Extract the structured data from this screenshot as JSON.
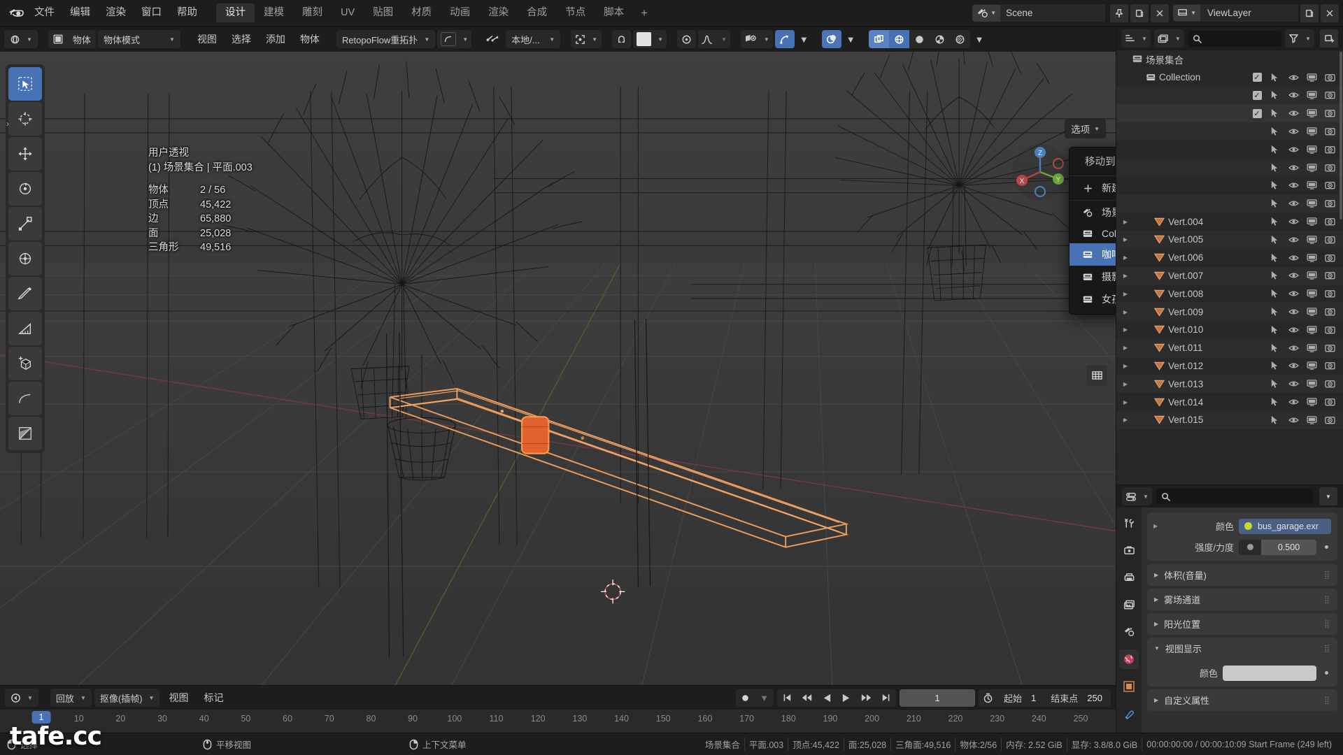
{
  "app": {
    "logo_icon": "blender-logo-icon"
  },
  "topbar": {
    "menus": [
      "文件",
      "编辑",
      "渲染",
      "窗口",
      "帮助"
    ],
    "workspaces": [
      "设计",
      "建模",
      "雕刻",
      "UV",
      "贴图",
      "材质",
      "动画",
      "渲染",
      "合成",
      "节点",
      "脚本"
    ],
    "active_workspace": "设计",
    "add_workspace_label": "+",
    "scene_name": "Scene",
    "viewlayer_name": "ViewLayer",
    "scene_icon": "scene-icon",
    "pin_icon": "pin-icon",
    "new_scene_icon": "new-scene-icon",
    "delete_scene_icon": "delete-scene-icon",
    "viewlayer_icon": "viewlayer-icon",
    "new_viewlayer_icon": "new-viewlayer-icon",
    "delete_viewlayer_icon": "delete-viewlayer-icon"
  },
  "viewport_header": {
    "editor_type_icon": "editor-type-3dview-icon",
    "mode_icon": "object-mode-icon",
    "mode_short_label": "物体",
    "mode_label": "物体模式",
    "menus": [
      "视图",
      "选择",
      "添加",
      "物体"
    ],
    "retopoflow_label": "RetopoFlow重拓扑",
    "retopoflow_tool_icon": "retopo-tool-icon",
    "transform_pivot_icon": "transform-pivot-icon",
    "orientation_label": "本地/...",
    "snap_icon": "snap-magnet-icon",
    "proportional_icon": "proportional-edit-icon",
    "visibility_icon": "object-visibility-icon",
    "gizmo_icon": "gizmo-icon",
    "overlays_icon": "overlays-icon",
    "xray_icon": "xray-icon",
    "shading_wireframe_icon": "shading-wireframe-icon",
    "shading_solid_icon": "shading-solid-icon",
    "shading_material_icon": "shading-material-icon",
    "shading_rendered_icon": "shading-rendered-icon",
    "options_label": "选项"
  },
  "viewport": {
    "view_name": "用户透视",
    "scene_path": "(1) 场景集合 | 平面.003",
    "stats": [
      {
        "label": "物体",
        "value": "2 / 56"
      },
      {
        "label": "顶点",
        "value": "45,422"
      },
      {
        "label": "边",
        "value": "65,880"
      },
      {
        "label": "面",
        "value": "25,028"
      },
      {
        "label": "三角形",
        "value": "49,516"
      }
    ],
    "tools": [
      "select-box-tool",
      "cursor-tool",
      "move-tool",
      "rotate-tool",
      "scale-tool",
      "transform-tool",
      "annotate-tool",
      "measure-tool",
      "add-cube-tool",
      "shear-tool",
      "to-sphere-tool"
    ],
    "gizmo_axes": [
      "X",
      "Y",
      "Z"
    ]
  },
  "context_menu": {
    "title": "移动到集合",
    "new_collection_label": "新建集合",
    "new_collection_icon": "plus-icon",
    "items": [
      {
        "label": "场景集合",
        "icon": "scene-collection-icon",
        "selected": false,
        "has_sub": false
      },
      {
        "label": "Collection",
        "icon": "collection-icon",
        "selected": false,
        "has_sub": false
      },
      {
        "label": "咖啡屋前景",
        "icon": "collection-icon",
        "selected": true,
        "has_sub": true
      },
      {
        "label": "摄影机与灯光",
        "icon": "collection-icon",
        "selected": false,
        "has_sub": false
      },
      {
        "label": "女孩",
        "icon": "collection-icon",
        "selected": false,
        "has_sub": true
      }
    ]
  },
  "outliner": {
    "editor_icon": "outliner-icon",
    "display_mode_icon": "view-layer-display-icon",
    "search_placeholder": "",
    "filter_icon": "filter-icon",
    "new_collection_icon": "new-collection-icon",
    "root": {
      "label": "场景集合",
      "icon": "scene-collection-icon"
    },
    "rows": [
      {
        "label": "Collection",
        "indent": 2,
        "icon": "collection-icon",
        "checkbox": true,
        "tri": false,
        "type": "collection"
      },
      {
        "label": "",
        "indent": 3,
        "icon": "",
        "checkbox": true,
        "tri": false,
        "type": "hidden"
      },
      {
        "label": "",
        "indent": 3,
        "icon": "",
        "checkbox": true,
        "tri": false,
        "type": "hidden-highlight"
      },
      {
        "label": "",
        "indent": 3,
        "icon": "",
        "checkbox": false,
        "tri": false,
        "type": "hidden"
      },
      {
        "label": "",
        "indent": 3,
        "icon": "",
        "checkbox": false,
        "tri": false,
        "type": "hidden"
      },
      {
        "label": "",
        "indent": 3,
        "icon": "",
        "checkbox": false,
        "tri": false,
        "type": "hidden"
      },
      {
        "label": "",
        "indent": 3,
        "icon": "",
        "checkbox": false,
        "tri": false,
        "type": "hidden"
      },
      {
        "label": "",
        "indent": 3,
        "icon": "",
        "checkbox": false,
        "tri": false,
        "type": "hidden"
      },
      {
        "label": "Vert.004",
        "indent": 3,
        "icon": "mesh-vert-icon",
        "checkbox": false,
        "tri": true,
        "type": "object"
      },
      {
        "label": "Vert.005",
        "indent": 3,
        "icon": "mesh-vert-icon",
        "checkbox": false,
        "tri": true,
        "type": "object"
      },
      {
        "label": "Vert.006",
        "indent": 3,
        "icon": "mesh-vert-icon",
        "checkbox": false,
        "tri": true,
        "type": "object"
      },
      {
        "label": "Vert.007",
        "indent": 3,
        "icon": "mesh-vert-icon",
        "checkbox": false,
        "tri": true,
        "type": "object"
      },
      {
        "label": "Vert.008",
        "indent": 3,
        "icon": "mesh-vert-icon",
        "checkbox": false,
        "tri": true,
        "type": "object"
      },
      {
        "label": "Vert.009",
        "indent": 3,
        "icon": "mesh-vert-icon",
        "checkbox": false,
        "tri": true,
        "type": "object"
      },
      {
        "label": "Vert.010",
        "indent": 3,
        "icon": "mesh-vert-icon",
        "checkbox": false,
        "tri": true,
        "type": "object"
      },
      {
        "label": "Vert.011",
        "indent": 3,
        "icon": "mesh-vert-icon",
        "checkbox": false,
        "tri": true,
        "type": "object"
      },
      {
        "label": "Vert.012",
        "indent": 3,
        "icon": "mesh-vert-icon",
        "checkbox": false,
        "tri": true,
        "type": "object"
      },
      {
        "label": "Vert.013",
        "indent": 3,
        "icon": "mesh-vert-icon",
        "checkbox": false,
        "tri": true,
        "type": "object"
      },
      {
        "label": "Vert.014",
        "indent": 3,
        "icon": "mesh-vert-icon",
        "checkbox": false,
        "tri": true,
        "type": "object"
      },
      {
        "label": "Vert.015",
        "indent": 3,
        "icon": "mesh-vert-icon",
        "checkbox": false,
        "tri": true,
        "type": "object"
      }
    ],
    "column_icons": [
      "select-arrow-icon",
      "eye-icon",
      "monitor-icon",
      "camera-icon"
    ]
  },
  "properties": {
    "editor_icon": "properties-icon",
    "search_placeholder": "",
    "tabs": [
      "tool-icon",
      "render-icon",
      "output-icon",
      "view-layer-icon",
      "scene-icon",
      "world-icon",
      "object-icon",
      "modifier-icon"
    ],
    "active_tab_index": 5,
    "color_label": "颜色",
    "color_value": "bus_garage.exr",
    "strength_label": "强度/力度",
    "strength_value": "0.500",
    "panels": [
      {
        "label": "体积(音量)",
        "open": false
      },
      {
        "label": "雾场通道",
        "open": false
      },
      {
        "label": "阳光位置",
        "open": false
      },
      {
        "label": "视图显示",
        "open": true
      },
      {
        "label": "自定义属性",
        "open": false
      }
    ],
    "viewport_display_color_label": "颜色"
  },
  "timeline": {
    "editor_icon": "timeline-icon",
    "menus": [
      "回放",
      "抠像(插帧)",
      "视图",
      "标记"
    ],
    "record_icon": "record-icon",
    "transport": [
      "jump-start-icon",
      "prev-keyframe-icon",
      "play-reverse-icon",
      "play-icon",
      "next-keyframe-icon",
      "jump-end-icon"
    ],
    "current_frame": "1",
    "clock_icon": "clock-icon",
    "start_label": "起始",
    "start_value": "1",
    "end_label": "结束点",
    "end_value": "250",
    "ticks": [
      1,
      10,
      20,
      30,
      40,
      50,
      60,
      70,
      80,
      90,
      100,
      110,
      120,
      130,
      140,
      150,
      160,
      170,
      180,
      190,
      200,
      210,
      220,
      230,
      240,
      250
    ],
    "playhead_frame": 1
  },
  "statusbar": {
    "hints": [
      {
        "icon": "mouse-left-icon",
        "label": "选择"
      },
      {
        "icon": "mouse-middle-icon",
        "label": "平移视图"
      },
      {
        "icon": "mouse-right-icon",
        "label": "上下文菜单"
      }
    ],
    "stats": [
      "场景集合",
      "平面.003",
      "顶点:45,422",
      "面:25,028",
      "三角面:49,516",
      "物体:2/56",
      "内存: 2.52 GiB",
      "显存: 3.8/8.0 GiB",
      "00:00:00:00 / 00:00:10:09  Start Frame (249 left)"
    ]
  },
  "watermark": {
    "text": "tafe.cc"
  },
  "colors": {
    "accent_blue": "#4772b3",
    "viewport_bg": "#393939",
    "panel_bg": "#303030",
    "header_bg": "#1d1d1d",
    "selected_orange": "#ed9e5c",
    "active_orange": "#ff8b22"
  }
}
